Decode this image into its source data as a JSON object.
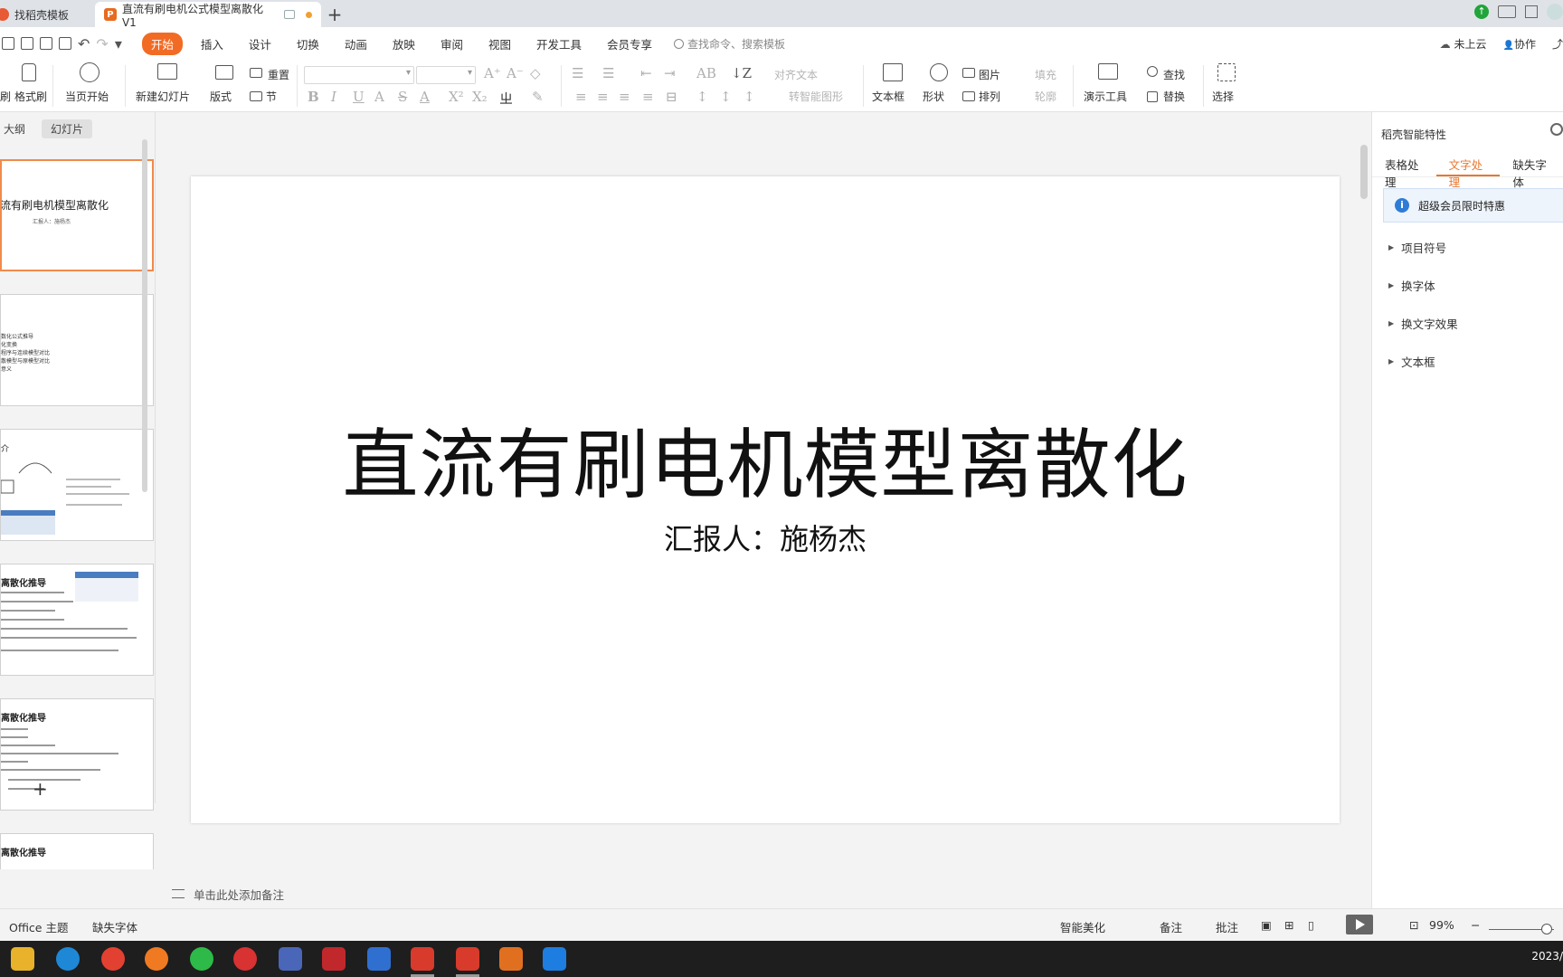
{
  "tabs": [
    {
      "label": "找稻壳模板"
    },
    {
      "label": "直流有刷电机公式模型离散化V1"
    }
  ],
  "menu": {
    "items": [
      "开始",
      "插入",
      "设计",
      "切换",
      "动画",
      "放映",
      "审阅",
      "视图",
      "开发工具",
      "会员专享"
    ],
    "search_placeholder": "查找命令、搜索模板",
    "cloud": "未上云",
    "collab": "协作"
  },
  "ribbon": {
    "brush": "刷",
    "format_painter": "格式刷",
    "play_from_current": "当页开始",
    "new_slide": "新建幻灯片",
    "layout": "版式",
    "reset": "重置",
    "section": "节",
    "align_text": "对齐文本",
    "smart_graphic": "转智能图形",
    "textbox": "文本框",
    "shape": "形状",
    "picture": "图片",
    "arrange": "排列",
    "fill": "填充",
    "outline": "轮廓",
    "presentation_tools": "演示工具",
    "find": "查找",
    "replace": "替换",
    "select": "选择"
  },
  "left_panel": {
    "tabs": [
      "大纲",
      "幻灯片"
    ],
    "slides": [
      {
        "title": "流有刷电机模型离散化",
        "subtitle": "汇报人：施杨杰"
      },
      {
        "lines": [
          "数化公式推导",
          "化变换",
          "程序与连续模型对比",
          "散模型与原模型对比",
          "意义"
        ]
      },
      {
        "title": "介"
      },
      {
        "title": "离散化推导"
      },
      {
        "title": "离散化推导"
      },
      {
        "title": "离散化推导"
      }
    ]
  },
  "slide": {
    "title": "直流有刷电机模型离散化",
    "subtitle": "汇报人：施杨杰"
  },
  "notes_placeholder": "单击此处添加备注",
  "right_panel": {
    "header": "稻壳智能特性",
    "tabs": [
      "表格处理",
      "文字处理",
      "缺失字体"
    ],
    "promo": "超级会员限时特惠",
    "items": [
      "项目符号",
      "换字体",
      "换文字效果",
      "文本框"
    ]
  },
  "status": {
    "theme": "Office 主题",
    "missing_font": "缺失字体",
    "beautify": "智能美化",
    "notes": "备注",
    "comments": "批注",
    "zoom": "99%"
  },
  "taskbar": {
    "time": "2023/"
  }
}
